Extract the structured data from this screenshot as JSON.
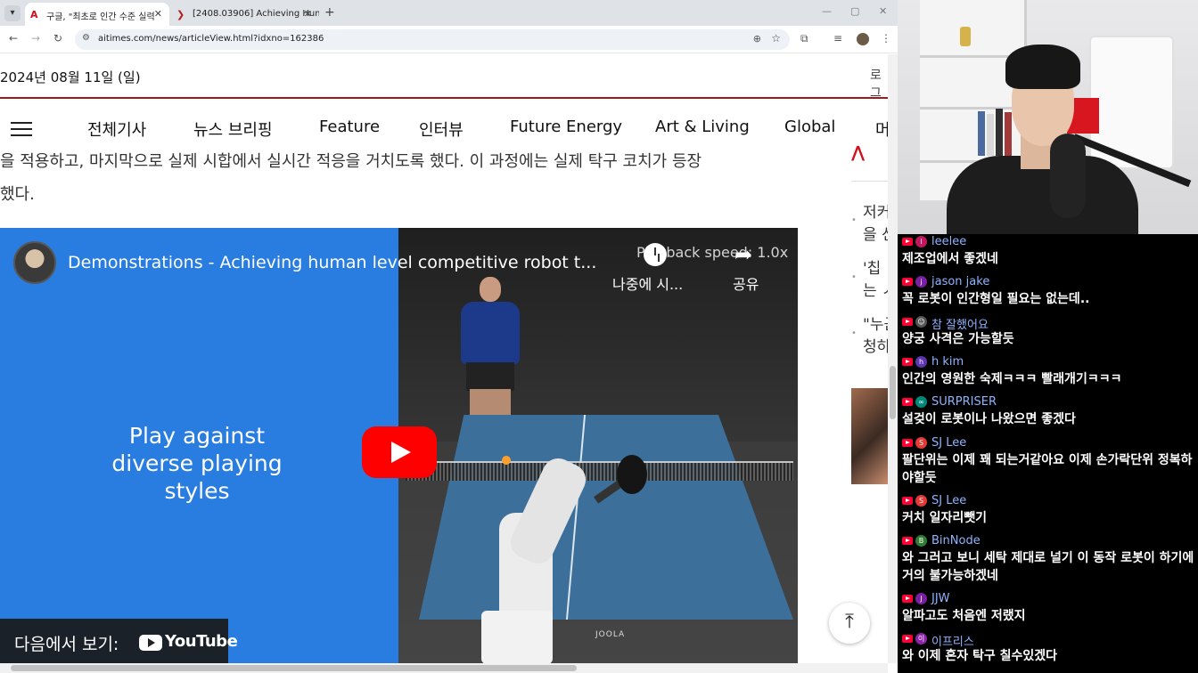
{
  "browser": {
    "tabs": [
      {
        "label": "구글, \"최초로 인간 수준 실력",
        "favicon": "A",
        "favicon_color": "#d0111b",
        "active": true
      },
      {
        "label": "[2408.03906] Achieving Huma",
        "favicon": "❯",
        "favicon_color": "#b31b1b",
        "active": false
      }
    ],
    "tab_list_icon": "▾",
    "new_tab_icon": "+",
    "window_controls": [
      "—",
      "▢",
      "✕"
    ],
    "url": "aitimes.com/news/articleView.html?idxno=162386",
    "nav": {
      "back": "←",
      "forward": "→",
      "reload": "↻"
    },
    "icons": {
      "zoom": "⊕",
      "bookmark": "☆",
      "extensions": "⧉",
      "media": "≡",
      "menu": "⋮",
      "site_info": "⚙"
    }
  },
  "article": {
    "date": "2024년 08월 11일 (일)",
    "login": "로그",
    "nav_items": [
      "전체기사",
      "뉴스 브리핑",
      "Feature",
      "인터뷰",
      "Future Energy",
      "Art & Living",
      "Global",
      "머"
    ],
    "body_lines": [
      "을 적용하고, 마지막으로 실제 시합에서 실시간 적응을 거치도록 했다. 이 과정에는 실제 탁구 코치가 등장",
      "했다."
    ],
    "sidebar_lines": [
      "저커",
      "을 선",
      "'칩 ",
      "는 ㅅ",
      "\"누근",
      "청하"
    ],
    "scroll_top_icon": "⤒"
  },
  "video": {
    "title": "Demonstrations - Achieving human level competitive robot t...",
    "playback_overlay": "Playback speed: 1.0x",
    "watch_later": "나중에 시...",
    "share": "공유",
    "share_icon": "➦",
    "promo_text": "Play against diverse playing styles",
    "watch_on": "다음에서 보기:",
    "youtube_word": "YouTube",
    "table_brand": "JOOLA"
  },
  "chat": {
    "messages": [
      {
        "user": "leelee",
        "avatar": "l",
        "avatar_color": "#c2185b",
        "name_color": "#8fb4ff",
        "text": "제조업에서 좋겠네"
      },
      {
        "user": "jason jake",
        "avatar": "j",
        "avatar_color": "#7b1fa2",
        "name_color": "#8fb4ff",
        "text": "꼭 로봇이 인간형일 필요는 없는데.."
      },
      {
        "user": "참 잘했어요",
        "avatar": "☺",
        "avatar_color": "#555555",
        "name_color": "#8fb4ff",
        "text": "양궁 사격은 가능할듯"
      },
      {
        "user": "h kim",
        "avatar": "h",
        "avatar_color": "#5e35b1",
        "name_color": "#8fb4ff",
        "text": "인간의 영원한 숙제ㅋㅋㅋ 빨래개기ㅋㅋㅋ"
      },
      {
        "user": "SURPRISER",
        "avatar": "∞",
        "avatar_color": "#00897b",
        "name_color": "#8fb4ff",
        "text": "설겆이 로봇이나 나왔으면 좋겠다"
      },
      {
        "user": "SJ Lee",
        "avatar": "S",
        "avatar_color": "#e53935",
        "name_color": "#8fb4ff",
        "text": "팔단위는 이제 꽤 되는거같아요 이제 손가락단위 정복하야할듯"
      },
      {
        "user": "SJ Lee",
        "avatar": "S",
        "avatar_color": "#e53935",
        "name_color": "#8fb4ff",
        "text": "커치 일자리뺏기"
      },
      {
        "user": "BinNode",
        "avatar": "B",
        "avatar_color": "#2e7d32",
        "name_color": "#8fb4ff",
        "text": "와 그러고 보니 세탁 제대로 널기 이 동작 로봇이 하기에 거의 불가능하겠네"
      },
      {
        "user": "JJW",
        "avatar": "J",
        "avatar_color": "#7b1fa2",
        "name_color": "#8fb4ff",
        "text": "알파고도 처음엔 저랬지"
      },
      {
        "user": "이프리스",
        "avatar": "이",
        "avatar_color": "#8e24aa",
        "name_color": "#8fb4ff",
        "text": "와 이제 혼자 탁구 칠수있겠다"
      }
    ]
  }
}
